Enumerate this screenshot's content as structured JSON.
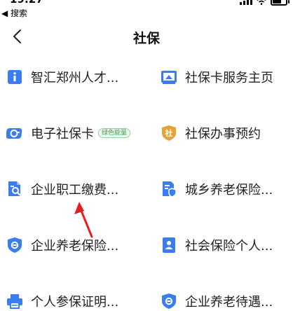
{
  "status_bar": {
    "time": "19:27",
    "back_label": "◀ 搜索"
  },
  "nav": {
    "title": "社保"
  },
  "items": [
    {
      "label": "智汇郑州人才...",
      "icon": "info-icon"
    },
    {
      "label": "社保卡服务主页",
      "icon": "card-home-icon"
    },
    {
      "label": "电子社保卡",
      "icon": "e-card-icon",
      "badge": "绿色能量"
    },
    {
      "label": "社保办事预约",
      "icon": "shield-she-icon"
    },
    {
      "label": "企业职工缴费...",
      "icon": "doc-search-icon"
    },
    {
      "label": "城乡养老保险...",
      "icon": "doc-shield-icon"
    },
    {
      "label": "企业养老保险...",
      "icon": "shield-circle-icon"
    },
    {
      "label": "社会保险个人...",
      "icon": "person-doc-icon"
    },
    {
      "label": "个人参保证明...",
      "icon": "printer-icon"
    },
    {
      "label": "企业养老待遇...",
      "icon": "shield-circle-icon"
    }
  ],
  "colors": {
    "accent_blue": "#3b7cf0",
    "orange": "#e8a23a",
    "arrow_red": "#e41e1e",
    "badge_green": "#3aa14a"
  }
}
